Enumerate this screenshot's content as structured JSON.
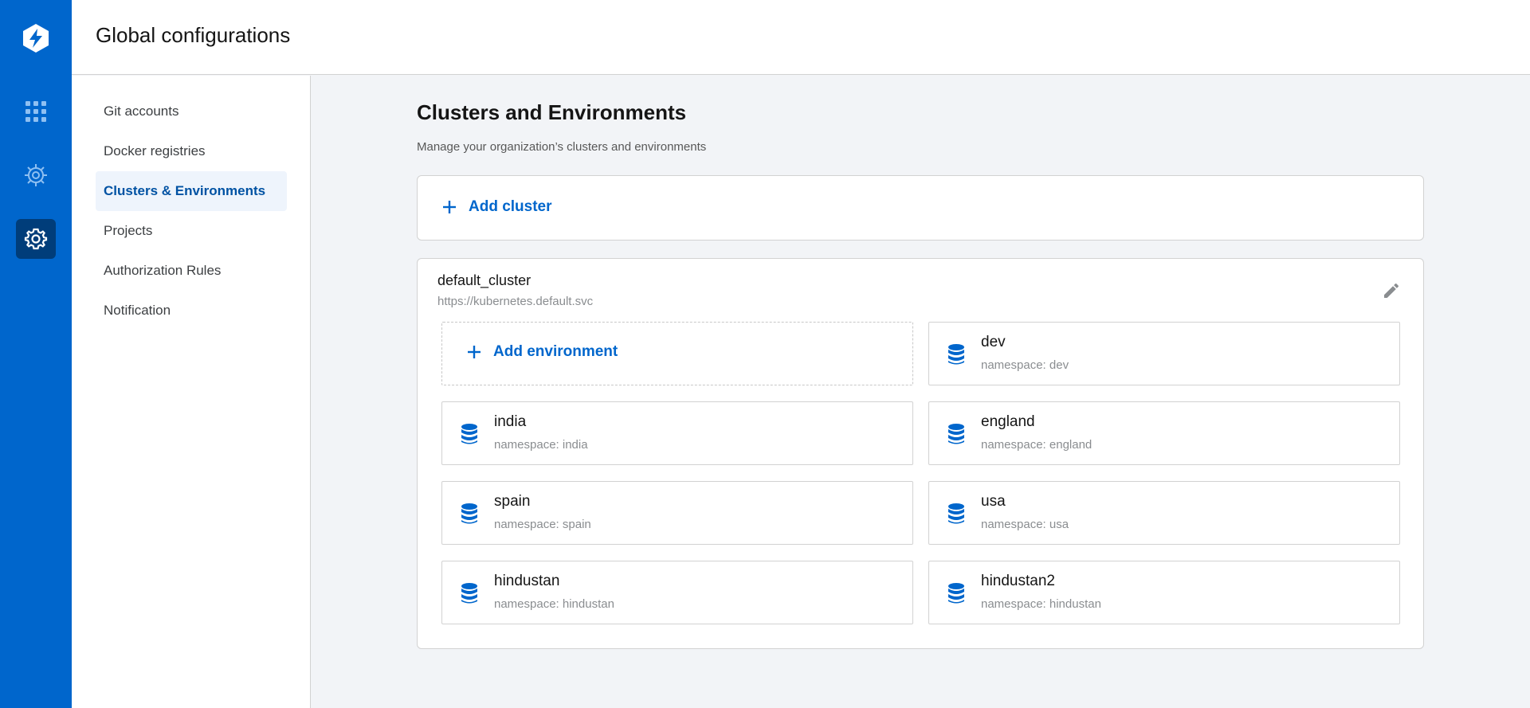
{
  "header": {
    "title": "Global configurations"
  },
  "rail": {
    "items": [
      {
        "icon": "logo-icon"
      },
      {
        "icon": "apps-grid-icon"
      },
      {
        "icon": "bug-icon"
      },
      {
        "icon": "gear-icon",
        "active": true
      }
    ]
  },
  "subnav": {
    "items": [
      {
        "label": "Git accounts"
      },
      {
        "label": "Docker registries"
      },
      {
        "label": "Clusters & Environments",
        "active": true
      },
      {
        "label": "Projects"
      },
      {
        "label": "Authorization Rules"
      },
      {
        "label": "Notification"
      }
    ]
  },
  "main": {
    "title": "Clusters and Environments",
    "subtitle": "Manage your organization’s clusters and environments",
    "add_cluster_label": "Add cluster",
    "cluster": {
      "name": "default_cluster",
      "url": "https://kubernetes.default.svc",
      "add_environment_label": "Add environment",
      "environments": [
        {
          "name": "dev",
          "namespace": "namespace: dev"
        },
        {
          "name": "india",
          "namespace": "namespace: india"
        },
        {
          "name": "england",
          "namespace": "namespace: england"
        },
        {
          "name": "spain",
          "namespace": "namespace: spain"
        },
        {
          "name": "usa",
          "namespace": "namespace: usa"
        },
        {
          "name": "hindustan",
          "namespace": "namespace: hindustan"
        },
        {
          "name": "hindustan2",
          "namespace": "namespace: hindustan"
        }
      ]
    }
  },
  "colors": {
    "brand": "#0066cc",
    "rail_active": "#003d7a",
    "nav_active_bg": "#eef4fc"
  }
}
